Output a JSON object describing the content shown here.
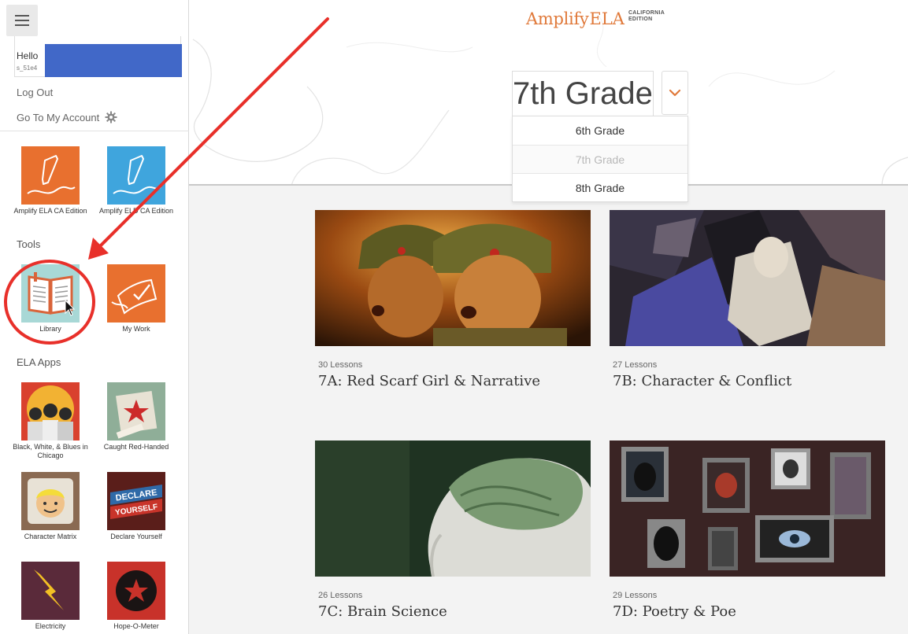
{
  "brand": {
    "name": "Amplify",
    "suffix": "ELA",
    "edition_line1": "CALIFORNIA",
    "edition_line2": "EDITION"
  },
  "grade": {
    "current": "7th Grade",
    "options": [
      "6th Grade",
      "7th Grade",
      "8th Grade"
    ],
    "selected": "7th Grade"
  },
  "sidebar": {
    "greeting": "Hello",
    "username": "s_51e4",
    "logout": "Log Out",
    "account": "Go To My Account",
    "programs": [
      {
        "label": "Amplify ELA CA Edition",
        "icon": "pen-icon",
        "color": "#e8702f"
      },
      {
        "label": "Amplify ELD CA Edition",
        "icon": "pen-icon",
        "color": "#3fa5dd"
      }
    ],
    "tools_heading": "Tools",
    "tools": [
      {
        "label": "Library",
        "icon": "book-icon"
      },
      {
        "label": "My Work",
        "icon": "checklist-icon"
      }
    ],
    "apps_heading": "ELA Apps",
    "apps": [
      {
        "label": "Black, White, & Blues in Chicago",
        "icon": "people-icon"
      },
      {
        "label": "Caught Red-Handed",
        "icon": "star-film-icon"
      },
      {
        "label": "Character Matrix",
        "icon": "face-icon"
      },
      {
        "label": "Declare Yourself",
        "icon": "banner-icon"
      },
      {
        "label": "Electricity",
        "icon": "lightning-icon"
      },
      {
        "label": "Hope-O-Meter",
        "icon": "star-icon"
      }
    ],
    "declare_banner_1": "DECLARE",
    "declare_banner_2": "YOURSELF"
  },
  "units": [
    {
      "lessons": "30 Lessons",
      "title": "7A: Red Scarf Girl & Narrative"
    },
    {
      "lessons": "27 Lessons",
      "title": "7B: Character & Conflict"
    },
    {
      "lessons": "26 Lessons",
      "title": "7C: Brain Science"
    },
    {
      "lessons": "29 Lessons",
      "title": "7D: Poetry & Poe"
    }
  ],
  "colors": {
    "accent": "#e0793a",
    "annotation": "#e8302a",
    "redaction": "#4168c8"
  }
}
